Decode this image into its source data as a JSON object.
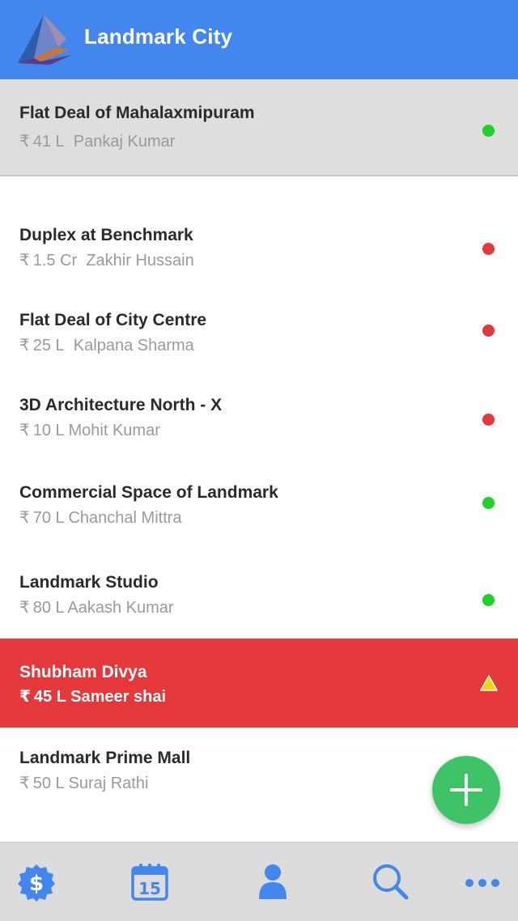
{
  "header": {
    "title": "Landmark City",
    "accent": "#4286ee"
  },
  "deals": [
    {
      "title": "Flat Deal of Mahalaxmipuram",
      "currency": "₹",
      "amount": "41 L",
      "person": "Pankaj Kumar",
      "status": "green",
      "pinned": true
    },
    {
      "title": "Duplex at Benchmark",
      "currency": "₹",
      "amount": "1.5 Cr",
      "person": "Zakhir Hussain",
      "status": "red"
    },
    {
      "title": "Flat Deal of City Centre",
      "currency": "₹",
      "amount": "25 L",
      "person": "Kalpana Sharma",
      "status": "red"
    },
    {
      "title": "3D Architecture North - X",
      "currency": "₹",
      "amount": "10 L",
      "person": "Mohit Kumar",
      "status": "red"
    },
    {
      "title": "Commercial Space of Landmark",
      "currency": "₹",
      "amount": "70 L",
      "person": "Chanchal Mittra",
      "status": "green"
    },
    {
      "title": "Landmark Studio",
      "currency": "₹",
      "amount": "80 L",
      "person": "Aakash Kumar",
      "status": "green"
    },
    {
      "title": "Shubham Divya",
      "currency": "₹",
      "amount": "45 L",
      "person": "Sameer shai",
      "status": "warning",
      "highlight": "#e5383b"
    },
    {
      "title": "Landmark Prime Mall",
      "currency": "₹",
      "amount": "50 L",
      "person": "Suraj Rathi",
      "status": "none"
    }
  ],
  "fab": {
    "icon": "plus-icon",
    "color": "#3ec467"
  },
  "tabbar": {
    "calendar_day": "15",
    "items": [
      {
        "icon": "dollar-badge-icon"
      },
      {
        "icon": "calendar-icon"
      },
      {
        "icon": "person-icon"
      },
      {
        "icon": "search-icon"
      },
      {
        "icon": "more-icon"
      }
    ]
  },
  "status_colors": {
    "green": "#1fcf2a",
    "red": "#e5383b",
    "warning": "#f2d600"
  }
}
